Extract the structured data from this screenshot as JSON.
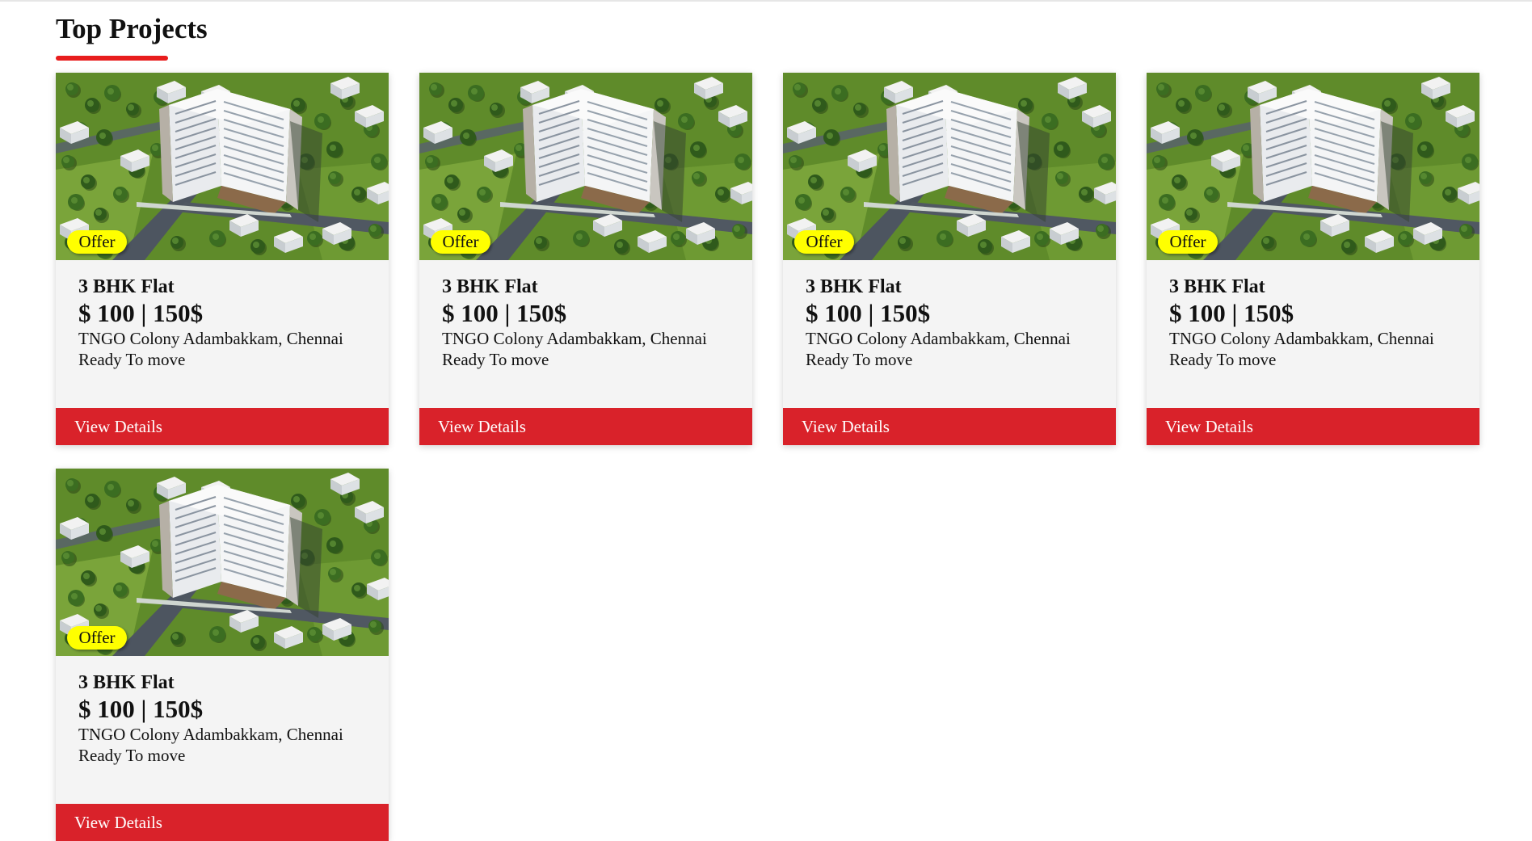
{
  "section": {
    "title": "Top Projects"
  },
  "colors": {
    "accent_red": "#d9222a",
    "underline_red": "#e81d1d",
    "badge_yellow": "#ffff00"
  },
  "cards": [
    {
      "badge": "Offer",
      "title": "3 BHK Flat",
      "price": "$ 100 | 150$",
      "location": "TNGO Colony Adambakkam, Chennai",
      "status": "Ready To move",
      "button": "View Details"
    },
    {
      "badge": "Offer",
      "title": "3 BHK Flat",
      "price": "$ 100 | 150$",
      "location": "TNGO Colony Adambakkam, Chennai",
      "status": "Ready To move",
      "button": "View Details"
    },
    {
      "badge": "Offer",
      "title": "3 BHK Flat",
      "price": "$ 100 | 150$",
      "location": "TNGO Colony Adambakkam, Chennai",
      "status": "Ready To move",
      "button": "View Details"
    },
    {
      "badge": "Offer",
      "title": "3 BHK Flat",
      "price": "$ 100 | 150$",
      "location": "TNGO Colony Adambakkam, Chennai",
      "status": "Ready To move",
      "button": "View Details"
    },
    {
      "badge": "Offer",
      "title": "3 BHK Flat",
      "price": "$ 100 | 150$",
      "location": "TNGO Colony Adambakkam, Chennai",
      "status": "Ready To move",
      "button": "View Details"
    }
  ]
}
